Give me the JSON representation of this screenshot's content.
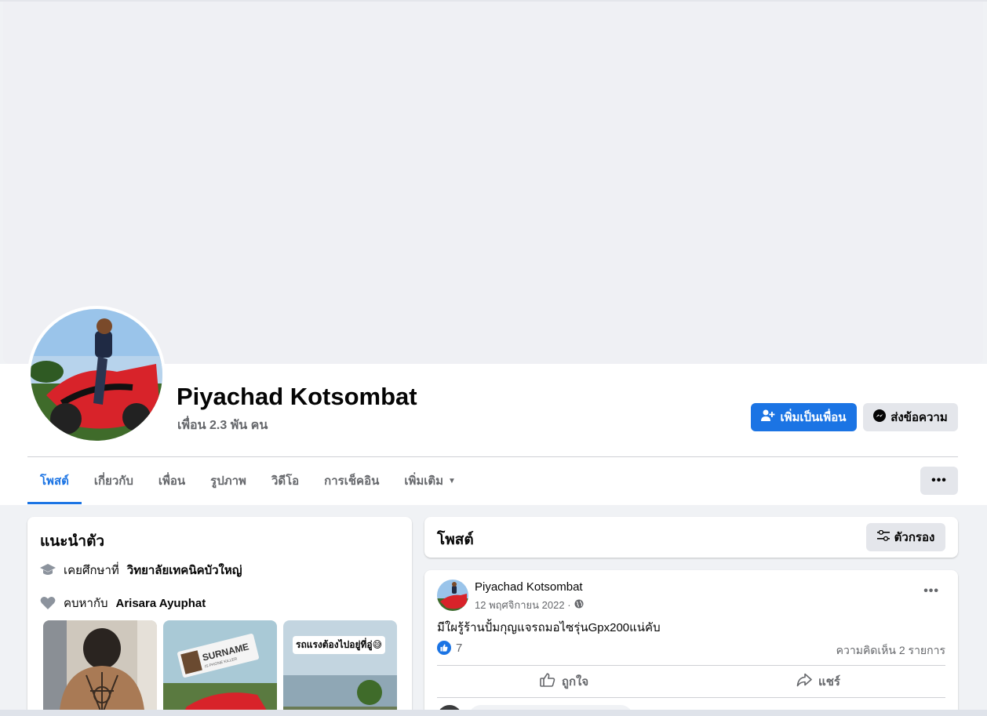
{
  "profile": {
    "name": "Piyachad Kotsombat",
    "friends": "เพื่อน 2.3 พัน คน",
    "add_friend_label": "เพิ่มเป็นเพื่อน",
    "message_label": "ส่งข้อความ"
  },
  "tabs": [
    {
      "label": "โพสต์",
      "active": true
    },
    {
      "label": "เกี่ยวกับ",
      "active": false
    },
    {
      "label": "เพื่อน",
      "active": false
    },
    {
      "label": "รูปภาพ",
      "active": false
    },
    {
      "label": "วิดีโอ",
      "active": false
    },
    {
      "label": "การเช็คอิน",
      "active": false
    },
    {
      "label": "เพิ่มเติม",
      "active": false
    }
  ],
  "more_label": "•••",
  "intro": {
    "title": "แนะนำตัว",
    "education_prefix": "เคยศึกษาที่",
    "education_place": "วิทยาลัยเทคนิคบัวใหญ่",
    "relationship_prefix": "คบหากับ",
    "relationship_partner": "Arisara Ayuphat",
    "photo_badge_text": "SURNAME",
    "photo_badge_sub": "IS PHONE KILLER",
    "photo_caption": "รถแรงต้องไปอยู่ที่อู่😅"
  },
  "posts": {
    "title": "โพสต์",
    "filter_label": "ตัวกรอง"
  },
  "post": {
    "author": "Piyachad Kotsombat",
    "date": "12 พฤศจิกายน 2022 ·",
    "text": "มีใผรู้ร้านปั้มกุญแจรถมอไซรุ่นGpx200แน่คับ",
    "like_count": "7",
    "comments": "ความคิดเห็น 2 รายการ",
    "like_label": "ถูกใจ",
    "share_label": "แชร์",
    "dots": "•••"
  },
  "colors": {
    "accent": "#1b74e4",
    "secondary_button": "#e4e6eb",
    "page_bg": "#f0f2f5",
    "muted_text": "#65676b"
  }
}
